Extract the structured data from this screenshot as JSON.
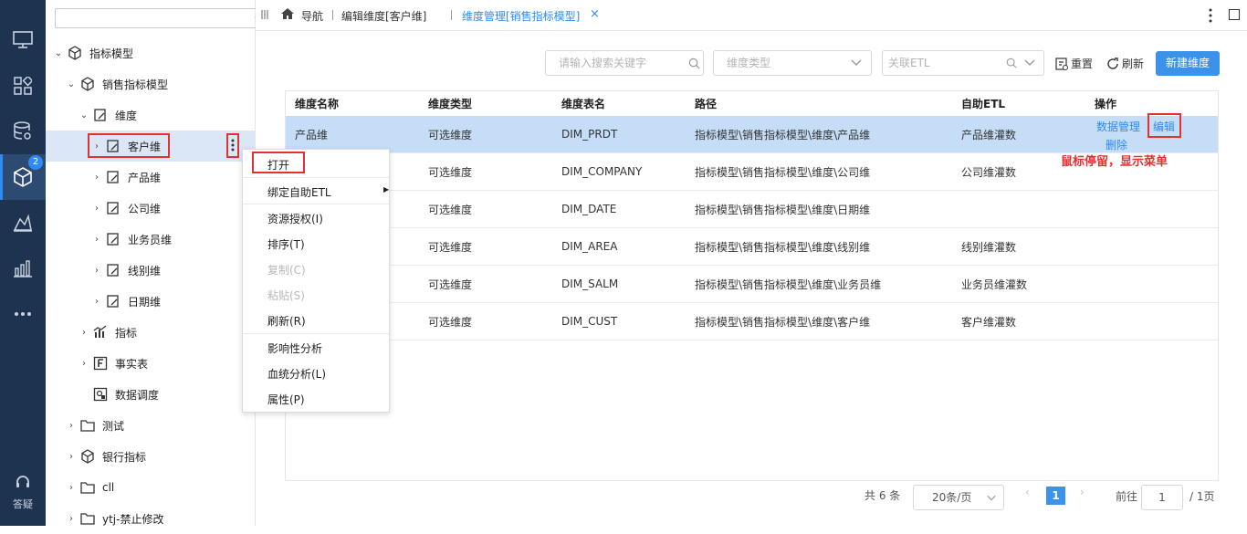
{
  "rail": {
    "badge": "2",
    "help_label": "答疑"
  },
  "tree": {
    "search_placeholder": "",
    "nodes": [
      {
        "label": "指标模型"
      },
      {
        "label": "销售指标模型"
      },
      {
        "label": "维度"
      },
      {
        "label": "客户维"
      },
      {
        "label": "产品维"
      },
      {
        "label": "公司维"
      },
      {
        "label": "业务员维"
      },
      {
        "label": "线别维"
      },
      {
        "label": "日期维"
      },
      {
        "label": "指标"
      },
      {
        "label": "事实表"
      },
      {
        "label": "数据调度"
      },
      {
        "label": "测试"
      },
      {
        "label": "银行指标"
      },
      {
        "label": "cll"
      },
      {
        "label": "ytj-禁止修改"
      }
    ]
  },
  "tabs": {
    "nav": "导航",
    "tab1": "编辑维度[客户维]",
    "tab2": "维度管理[销售指标模型]"
  },
  "toolbar": {
    "search_placeholder": "请输入搜索关键字",
    "type_placeholder": "维度类型",
    "etl_placeholder": "关联ETL",
    "reset": "重置",
    "refresh": "刷新",
    "new_dim": "新建维度"
  },
  "table": {
    "headers": [
      "维度名称",
      "维度类型",
      "维度表名",
      "路径",
      "自助ETL",
      "操作"
    ],
    "rows": [
      {
        "name": "产品维",
        "type": "可选维度",
        "table": "DIM_PRDT",
        "path": "指标模型\\销售指标模型\\维度\\产品维",
        "etl": "产品维灌数"
      },
      {
        "name": "",
        "type": "可选维度",
        "table": "DIM_COMPANY",
        "path": "指标模型\\销售指标模型\\维度\\公司维",
        "etl": "公司维灌数"
      },
      {
        "name": "",
        "type": "可选维度",
        "table": "DIM_DATE",
        "path": "指标模型\\销售指标模型\\维度\\日期维",
        "etl": ""
      },
      {
        "name": "",
        "type": "可选维度",
        "table": "DIM_AREA",
        "path": "指标模型\\销售指标模型\\维度\\线别维",
        "etl": "线别维灌数"
      },
      {
        "name": "",
        "type": "可选维度",
        "table": "DIM_SALM",
        "path": "指标模型\\销售指标模型\\维度\\业务员维",
        "etl": "业务员维灌数"
      },
      {
        "name": "",
        "type": "可选维度",
        "table": "DIM_CUST",
        "path": "指标模型\\销售指标模型\\维度\\客户维",
        "etl": "客户维灌数"
      }
    ],
    "ops": {
      "data_manage": "数据管理",
      "edit": "编辑",
      "delete": "删除"
    }
  },
  "annotation": "鼠标停留，显示菜单",
  "context_menu": {
    "items": [
      "打开",
      "绑定自助ETL",
      "资源授权(I)",
      "排序(T)",
      "复制(C)",
      "粘贴(S)",
      "刷新(R)",
      "影响性分析",
      "血统分析(L)",
      "属性(P)"
    ]
  },
  "pager": {
    "total": "共 6 条",
    "page_size": "20条/页",
    "current": "1",
    "goto_label": "前往",
    "goto_value": "1",
    "pages": "/ 1页"
  }
}
